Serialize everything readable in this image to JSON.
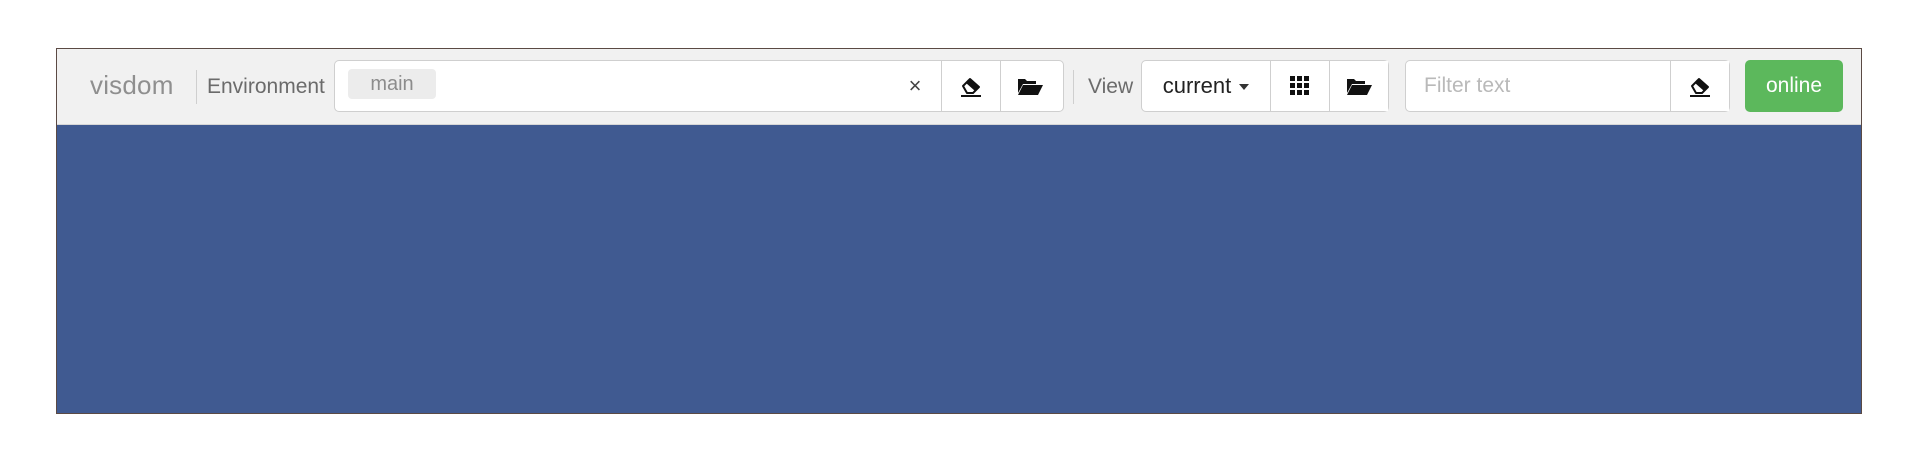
{
  "navbar": {
    "brand": "visdom",
    "environment_label": "Environment",
    "environment": {
      "selected_chip": "main",
      "clear_symbol": "×",
      "clear_icon": "close-icon",
      "erase_icon": "eraser-icon",
      "open_icon": "folder-open-icon"
    },
    "view_label": "View",
    "view": {
      "selected": "current",
      "layout_icon": "grid-icon",
      "open_icon": "folder-open-icon"
    },
    "filter": {
      "placeholder": "Filter text",
      "value": "",
      "erase_icon": "eraser-icon"
    },
    "status_button": "online"
  },
  "colors": {
    "content_background": "#405a91",
    "online_green": "#5cb85c",
    "navbar_background": "#f1f1f1"
  }
}
